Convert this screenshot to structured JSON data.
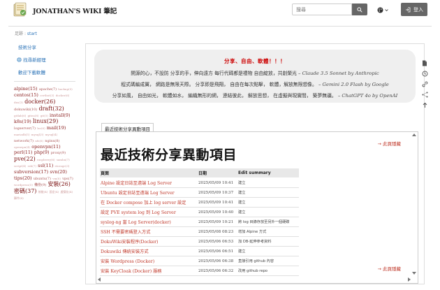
{
  "header": {
    "site_title": "JONATHAN'S WIKI 筆記",
    "search_placeholder": "搜尋",
    "login_label": "登入"
  },
  "breadcrumb": {
    "prefix": "足跡",
    "separator": ":",
    "current": "start"
  },
  "sidebar": {
    "links": [
      {
        "label": "技術分享"
      },
      {
        "label": "找尋新經理"
      },
      {
        "label": "歡迎下載軟體"
      }
    ],
    "tags": [
      {
        "text": "alpine(15)",
        "w": 3
      },
      {
        "text": "apache(7)",
        "w": 2
      },
      {
        "text": "backup(5)",
        "w": 1
      },
      {
        "text": "centos(15)",
        "w": 3
      },
      {
        "text": "certbot(3)",
        "w": 1
      },
      {
        "text": "docker(6)",
        "w": 1
      },
      {
        "text": "dns(3)",
        "w": 1
      },
      {
        "text": "docker(26)",
        "w": 4
      },
      {
        "text": "dokuwiki(10)",
        "w": 2
      },
      {
        "text": "draft(32)",
        "w": 4
      },
      {
        "text": "gitlab(6)",
        "w": 1
      },
      {
        "text": "gitea(8)",
        "w": 1
      },
      {
        "text": "git(5)",
        "w": 1
      },
      {
        "text": "install(9)",
        "w": 3
      },
      {
        "text": "k8s(19)",
        "w": 3
      },
      {
        "text": "linux(29)",
        "w": 4
      },
      {
        "text": "logserver(7)",
        "w": 2
      },
      {
        "text": "lxc(6)",
        "w": 1
      },
      {
        "text": "mail(19)",
        "w": 3
      },
      {
        "text": "mariadb(5)",
        "w": 1
      },
      {
        "text": "mysql(3)",
        "w": 1
      },
      {
        "text": "mysql(4)",
        "w": 1
      },
      {
        "text": "network(7)",
        "w": 2
      },
      {
        "text": "nfs(6)",
        "w": 1
      },
      {
        "text": "nginx(8)",
        "w": 2
      },
      {
        "text": "openvpn(4)",
        "w": 1
      },
      {
        "text": "openvpn(11)",
        "w": 3
      },
      {
        "text": "perl(11)",
        "w": 3
      },
      {
        "text": "php(9)",
        "w": 3
      },
      {
        "text": "proxy(9)",
        "w": 2
      },
      {
        "text": "pve(22)",
        "w": 4
      },
      {
        "text": "raspberry(6)",
        "w": 1
      },
      {
        "text": "samba(7)",
        "w": 1
      },
      {
        "text": "script(4)",
        "w": 1
      },
      {
        "text": "ssh(7)",
        "w": 1
      },
      {
        "text": "ssl(11)",
        "w": 3
      },
      {
        "text": "storage(3)",
        "w": 1
      },
      {
        "text": "subversion(17)",
        "w": 3
      },
      {
        "text": "svn(20)",
        "w": 3
      },
      {
        "text": "tips(20)",
        "w": 3
      },
      {
        "text": "ubuntu(7)",
        "w": 2
      },
      {
        "text": "vm(8)",
        "w": 1
      },
      {
        "text": "vps(7)",
        "w": 2
      },
      {
        "text": "wordpress(5)",
        "w": 1
      },
      {
        "text": "備份(9)",
        "w": 2
      },
      {
        "text": "安裝(26)",
        "w": 4
      },
      {
        "text": "密碼(37)",
        "w": 4
      },
      {
        "text": "效能(4)",
        "w": 1
      },
      {
        "text": "設定(4)",
        "w": 1
      },
      {
        "text": "虛擬化(4)",
        "w": 1
      },
      {
        "text": "郵件(8)",
        "w": 1
      }
    ]
  },
  "hero": {
    "title": "分享、自由、軟體！！！",
    "lines": [
      {
        "text": "開源的心，不設防 分享的手，伸向遠方 每行代碼都是禮物 自由綻放，共創榮光",
        "author": "– Claude 3.5 Sonnet by Anthropic"
      },
      {
        "text": "程式碼編成翼， 網路是無限天際。 分享即是飛翔， 自由在每次點擊， 軟體，解放無限想像。",
        "author": "– Gemini 2.0 Flash by Google"
      },
      {
        "text": "分享如風， 自由如光， 軟體如水， 編織無形的網， 連結彼此， 解放思想， 在虛擬與現實間， 築夢無疆。",
        "author": "– ChatGPT 4o by OpenAI"
      }
    ]
  },
  "panel": {
    "tab_label": "最近技術分享異動項目",
    "unsubscribe_label": "→ 此頁隱藏",
    "title": "最近技術分享異動項目",
    "columns": {
      "page": "頁面",
      "date": "日期",
      "summary": "Edit summary"
    },
    "rows": [
      {
        "page": "Alpine 設定日誌至遠端 Log Server",
        "date": "2025/05/09 10:41",
        "summary": "建立"
      },
      {
        "page": "Ubuntu 設定日誌至遠端 Log Server",
        "date": "2025/05/09 10:37",
        "summary": "建立"
      },
      {
        "page": "在 Docker compose 加上 log server 設定",
        "date": "2025/05/09 10:41",
        "summary": "建立"
      },
      {
        "page": "設定 PVE system log 到 Log Server",
        "date": "2025/05/09 10:40",
        "summary": "建立"
      },
      {
        "page": "syslog-ng 當 Log Server(docker)",
        "date": "2025/05/09 10:21",
        "summary": "將 log 目錄存放至另外一個硬碟"
      },
      {
        "page": "SSH 不需要密碼登入方式",
        "date": "2025/05/08 08:23",
        "summary": "增加 Alpine 方式"
      },
      {
        "page": "DokuWiki安裝程序(Docker)",
        "date": "2025/05/06 06:53",
        "summary": "加 DB-延伸參考資料"
      },
      {
        "page": "Dokuwiki 傳統安裝方式",
        "date": "2025/05/06 06:51",
        "summary": "建立"
      },
      {
        "page": "安裝 Wordpress (Docker)",
        "date": "2025/05/06 06:38",
        "summary": "直接引用 github 內容"
      },
      {
        "page": "安裝 KeyCloak (Docker) 服務",
        "date": "2025/05/06 06:32",
        "summary": "改用 github repo"
      }
    ]
  },
  "icons": [
    "logo-icon",
    "search-icon",
    "theme-icon",
    "login-icon",
    "pdf-icon",
    "revisions-icon",
    "backlinks-icon",
    "sitemap-icon",
    "top-icon"
  ]
}
